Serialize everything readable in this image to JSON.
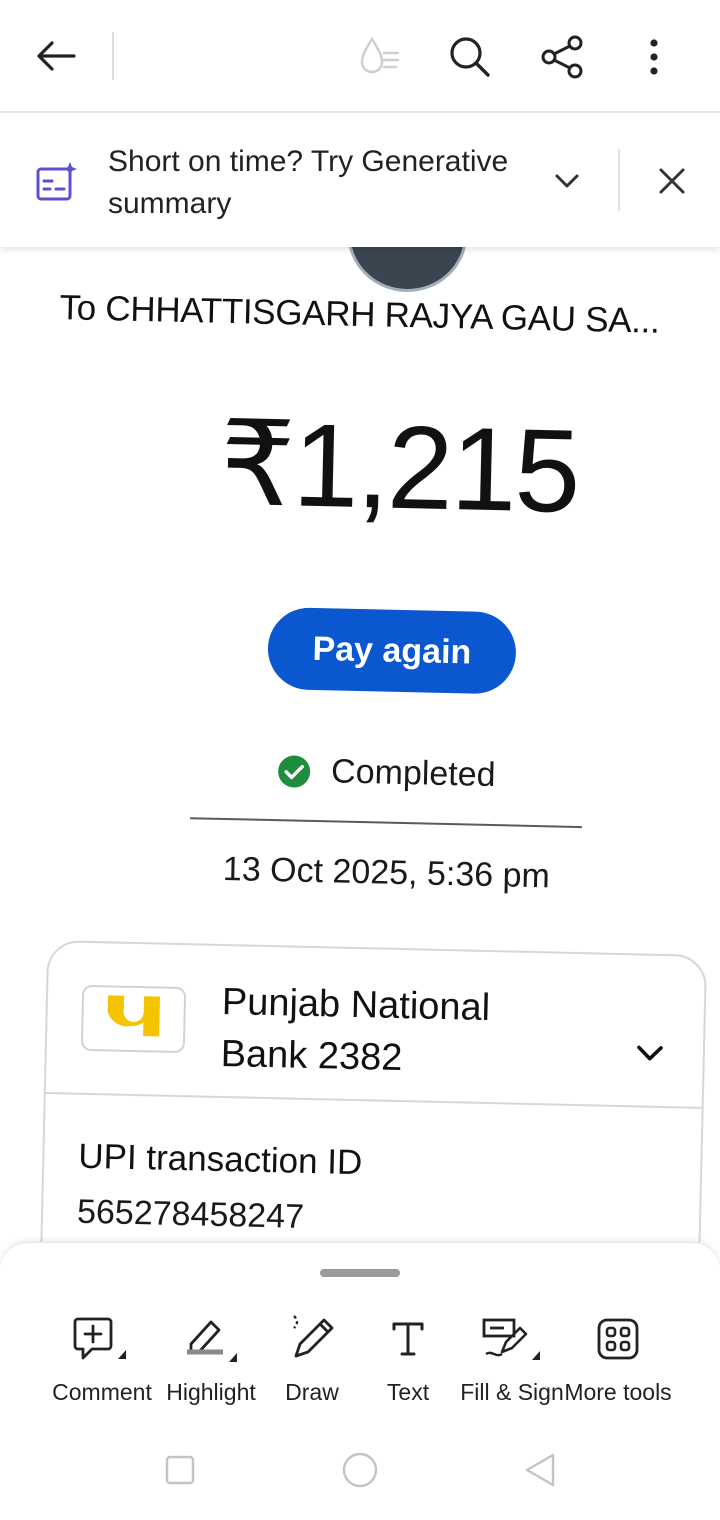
{
  "toolbar": {
    "back": "back-arrow-icon",
    "liquid_mode": "liquid-mode-icon",
    "search": "search-icon",
    "share": "share-icon",
    "more": "more-vertical-icon"
  },
  "banner": {
    "text": "Short on time? Try Generative summary",
    "icon": "generative-summary-icon"
  },
  "document": {
    "recipient": "To CHHATTISGARH RAJYA GAU SA...",
    "amount": "₹1,215",
    "pay_again_label": "Pay again",
    "status": "Completed",
    "status_color": "#1e8e3e",
    "timestamp": "13 Oct 2025, 5:36 pm",
    "bank": {
      "name": "Punjab National Bank 2382",
      "logo": "pnb-logo",
      "logo_color": "#f5c400"
    },
    "upi_label": "UPI transaction ID",
    "upi_value": "565278458247",
    "accent": "#0b57d0"
  },
  "tools": [
    {
      "label": "Comment",
      "icon": "comment-icon"
    },
    {
      "label": "Highlight",
      "icon": "highlight-icon"
    },
    {
      "label": "Draw",
      "icon": "draw-icon"
    },
    {
      "label": "Text",
      "icon": "text-icon"
    },
    {
      "label": "Fill & Sign",
      "icon": "fill-sign-icon"
    },
    {
      "label": "More tools",
      "icon": "more-tools-icon"
    }
  ],
  "nav": {
    "recents": "recents-square-icon",
    "home": "home-circle-icon",
    "back": "back-triangle-icon"
  }
}
